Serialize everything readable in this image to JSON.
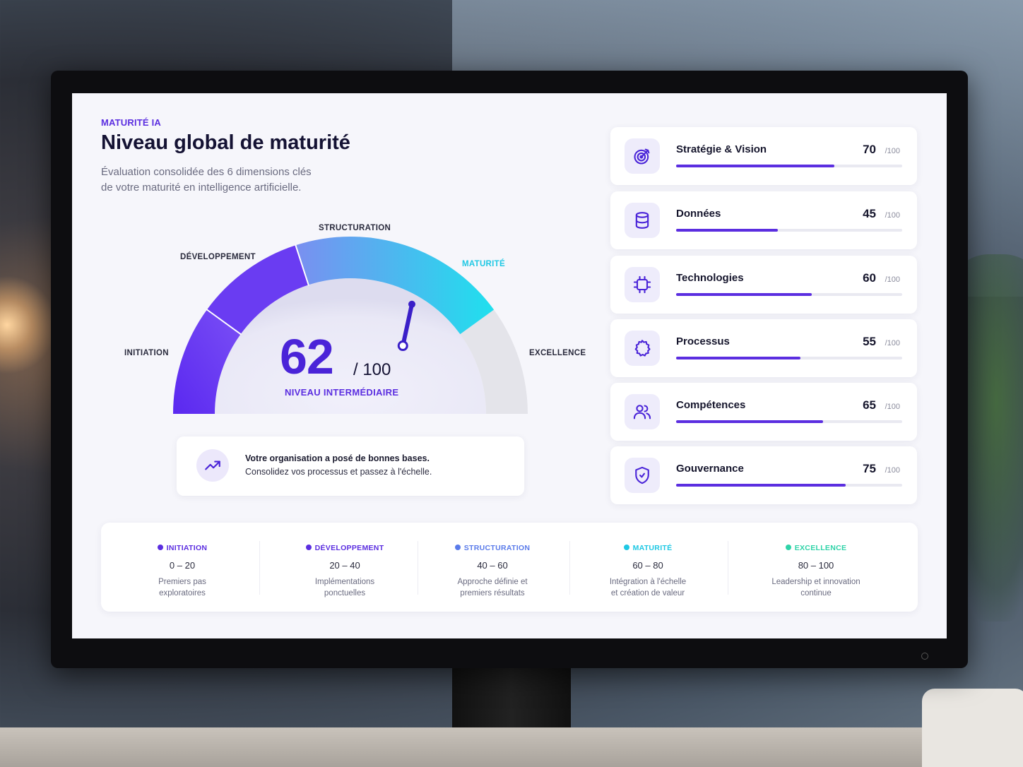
{
  "header": {
    "eyebrow": "MATURITÉ IA",
    "title": "Niveau global de maturité",
    "subtitle_line1": "Évaluation consolidée des 6 dimensions clés",
    "subtitle_line2": "de votre maturité en intelligence artificielle."
  },
  "gauge": {
    "score": "62",
    "max_label": "/ 100",
    "value": 62,
    "level_label": "NIVEAU INTERMÉDIAIRE",
    "stages": {
      "initiation": "INITIATION",
      "developpement": "DÉVELOPPEMENT",
      "structuration": "STRUCTURATION",
      "maturite": "MATURITÉ",
      "excellence": "EXCELLENCE"
    },
    "colors": {
      "primary": "#5b2ee0",
      "accent": "#1fd6ee",
      "track": "#e4e4ea"
    }
  },
  "insight": {
    "icon": "trending-up-icon",
    "line1": "Votre organisation a posé de bonnes bases.",
    "line2": "Consolidez vos processus et passez à l'échelle."
  },
  "dimensions": [
    {
      "name": "Stratégie & Vision",
      "score": "70",
      "max": "/100",
      "value": 70,
      "icon": "target-icon"
    },
    {
      "name": "Données",
      "score": "45",
      "max": "/100",
      "value": 45,
      "icon": "database-icon"
    },
    {
      "name": "Technologies",
      "score": "60",
      "max": "/100",
      "value": 60,
      "icon": "chip-icon"
    },
    {
      "name": "Processus",
      "score": "55",
      "max": "/100",
      "value": 55,
      "icon": "gear-icon"
    },
    {
      "name": "Compétences",
      "score": "65",
      "max": "/100",
      "value": 65,
      "icon": "users-icon"
    },
    {
      "name": "Gouvernance",
      "score": "75",
      "max": "/100",
      "value": 75,
      "icon": "shield-icon"
    }
  ],
  "legend": [
    {
      "name": "INITIATION",
      "range": "0 – 20",
      "desc1": "Premiers pas",
      "desc2": "exploratoires",
      "color": "#5b2ee0"
    },
    {
      "name": "DÉVELOPPEMENT",
      "range": "20 – 40",
      "desc1": "Implémentations",
      "desc2": "ponctuelles",
      "color": "#5b2ee0"
    },
    {
      "name": "STRUCTURATION",
      "range": "40 – 60",
      "desc1": "Approche définie et",
      "desc2": "premiers résultats",
      "color": "#5a7bea"
    },
    {
      "name": "MATURITÉ",
      "range": "60 – 80",
      "desc1": "Intégration à l'échelle",
      "desc2": "et création de valeur",
      "color": "#1fc8e4"
    },
    {
      "name": "EXCELLENCE",
      "range": "80 – 100",
      "desc1": "Leadership et innovation",
      "desc2": "continue",
      "color": "#2fd3a8"
    }
  ]
}
